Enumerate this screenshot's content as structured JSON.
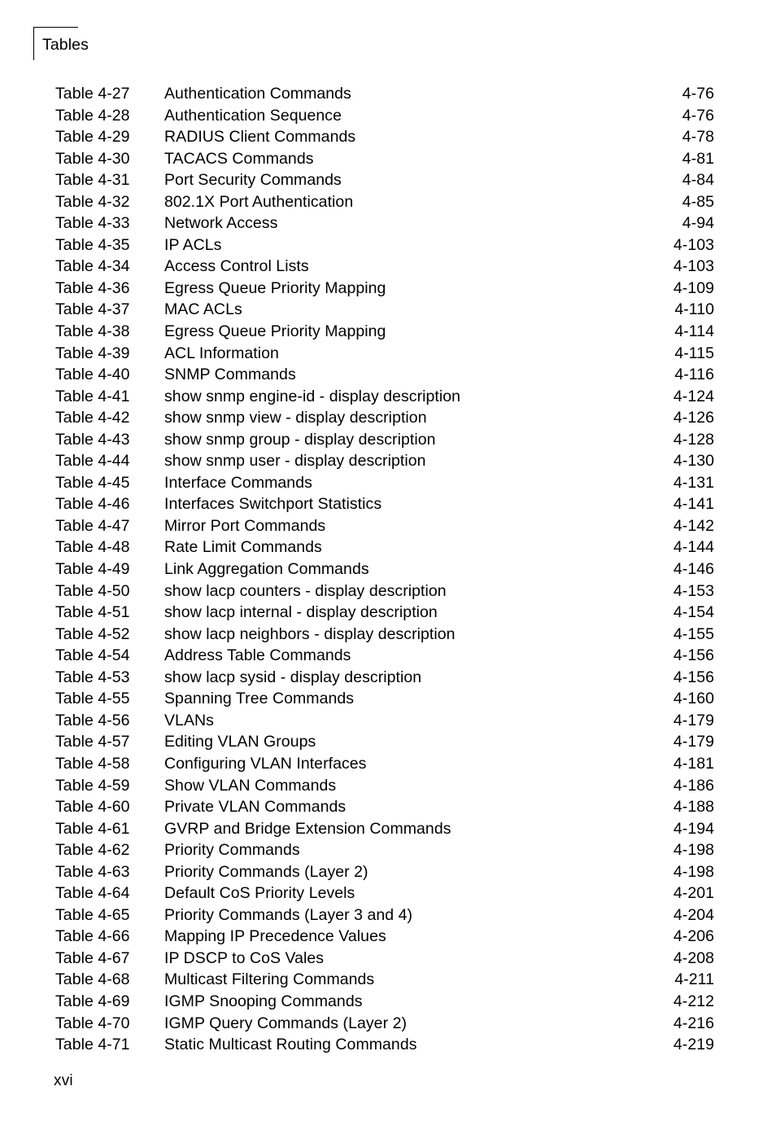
{
  "header": {
    "title": "Tables"
  },
  "footer": {
    "folio": "xvi"
  },
  "toc": {
    "rows": [
      {
        "label": "Table 4-27",
        "title": "Authentication Commands",
        "page": "4-76"
      },
      {
        "label": "Table 4-28",
        "title": "Authentication Sequence",
        "page": "4-76"
      },
      {
        "label": "Table 4-29",
        "title": "RADIUS Client Commands",
        "page": "4-78"
      },
      {
        "label": "Table 4-30",
        "title": "TACACS Commands",
        "page": "4-81"
      },
      {
        "label": "Table 4-31",
        "title": "Port Security Commands",
        "page": "4-84"
      },
      {
        "label": "Table 4-32",
        "title": "802.1X Port Authentication",
        "page": "4-85"
      },
      {
        "label": "Table 4-33",
        "title": "Network Access",
        "page": "4-94"
      },
      {
        "label": "Table 4-35",
        "title": "IP ACLs",
        "page": "4-103"
      },
      {
        "label": "Table 4-34",
        "title": "Access Control Lists",
        "page": "4-103"
      },
      {
        "label": "Table 4-36",
        "title": "Egress Queue Priority Mapping",
        "page": "4-109"
      },
      {
        "label": "Table 4-37",
        "title": "MAC ACLs",
        "page": "4-110"
      },
      {
        "label": "Table 4-38",
        "title": "Egress Queue Priority Mapping",
        "page": "4-114"
      },
      {
        "label": "Table 4-39",
        "title": "ACL Information",
        "page": "4-115"
      },
      {
        "label": "Table 4-40",
        "title": "SNMP Commands",
        "page": "4-116"
      },
      {
        "label": "Table 4-41",
        "title": "show snmp engine-id - display description",
        "page": "4-124"
      },
      {
        "label": "Table 4-42",
        "title": "show snmp view - display description",
        "page": "4-126"
      },
      {
        "label": "Table 4-43",
        "title": "show snmp group - display description",
        "page": "4-128"
      },
      {
        "label": "Table 4-44",
        "title": "show snmp user - display description",
        "page": "4-130"
      },
      {
        "label": "Table 4-45",
        "title": "Interface Commands",
        "page": "4-131"
      },
      {
        "label": "Table 4-46",
        "title": "Interfaces Switchport Statistics",
        "page": "4-141"
      },
      {
        "label": "Table 4-47",
        "title": "Mirror Port Commands",
        "page": "4-142"
      },
      {
        "label": "Table 4-48",
        "title": "Rate Limit Commands",
        "page": "4-144"
      },
      {
        "label": "Table 4-49",
        "title": "Link Aggregation Commands",
        "page": "4-146"
      },
      {
        "label": "Table 4-50",
        "title": "show lacp counters - display description",
        "page": "4-153"
      },
      {
        "label": "Table 4-51",
        "title": "show lacp internal - display description",
        "page": "4-154"
      },
      {
        "label": "Table 4-52",
        "title": "show lacp neighbors - display description",
        "page": "4-155"
      },
      {
        "label": "Table 4-54",
        "title": "Address Table Commands",
        "page": "4-156"
      },
      {
        "label": "Table 4-53",
        "title": "show lacp sysid - display description",
        "page": "4-156"
      },
      {
        "label": "Table 4-55",
        "title": "Spanning Tree Commands",
        "page": "4-160"
      },
      {
        "label": "Table 4-56",
        "title": "VLANs",
        "page": "4-179"
      },
      {
        "label": "Table 4-57",
        "title": "Editing VLAN Groups",
        "page": "4-179"
      },
      {
        "label": "Table 4-58",
        "title": "Configuring VLAN Interfaces",
        "page": "4-181"
      },
      {
        "label": "Table 4-59",
        "title": "Show VLAN Commands",
        "page": "4-186"
      },
      {
        "label": "Table 4-60",
        "title": "Private VLAN Commands",
        "page": "4-188"
      },
      {
        "label": "Table 4-61",
        "title": "GVRP and Bridge Extension Commands",
        "page": "4-194"
      },
      {
        "label": "Table 4-62",
        "title": "Priority Commands",
        "page": "4-198"
      },
      {
        "label": "Table 4-63",
        "title": "Priority Commands (Layer 2)",
        "page": "4-198"
      },
      {
        "label": "Table 4-64",
        "title": "Default CoS Priority Levels",
        "page": "4-201"
      },
      {
        "label": "Table 4-65",
        "title": "Priority Commands (Layer 3 and 4)",
        "page": "4-204"
      },
      {
        "label": "Table 4-66",
        "title": "Mapping IP Precedence Values",
        "page": "4-206"
      },
      {
        "label": "Table 4-67",
        "title": "IP DSCP to CoS Vales",
        "page": "4-208"
      },
      {
        "label": "Table 4-68",
        "title": "Multicast Filtering Commands",
        "page": "4-211"
      },
      {
        "label": "Table 4-69",
        "title": "IGMP Snooping Commands",
        "page": "4-212"
      },
      {
        "label": "Table 4-70",
        "title": "IGMP Query Commands (Layer 2)",
        "page": "4-216"
      },
      {
        "label": "Table 4-71",
        "title": "Static Multicast Routing Commands",
        "page": "4-219"
      }
    ]
  }
}
